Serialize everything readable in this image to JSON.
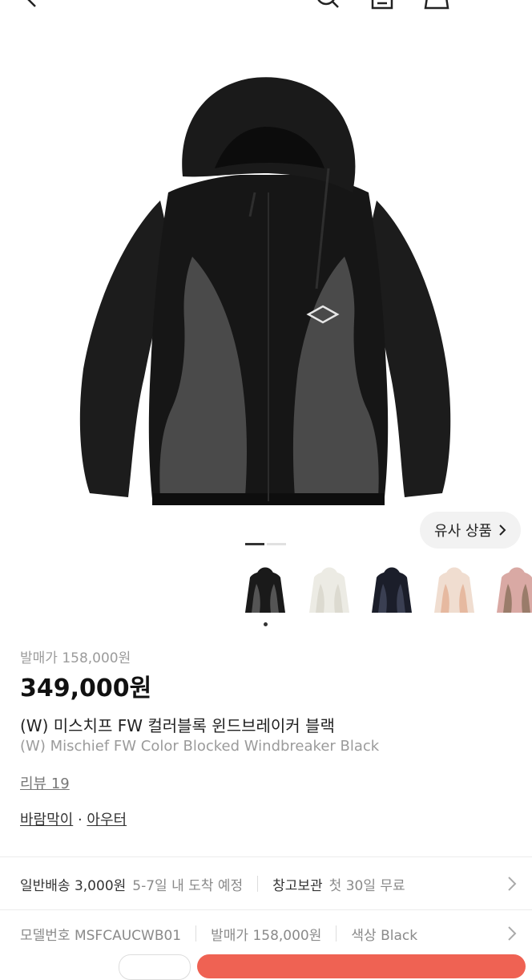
{
  "header": {
    "back_icon": "chevron-left-icon",
    "search_icon": "search-icon",
    "share_icon": "share-icon",
    "cart_icon": "shopping-bag-icon"
  },
  "gallery": {
    "similar_button_label": "유사 상품",
    "page_count": 2,
    "current_page": 1,
    "thumbnails": [
      {
        "color": "Black/Charcoal",
        "selected": true
      },
      {
        "color": "Ivory",
        "selected": false
      },
      {
        "color": "Navy",
        "selected": false
      },
      {
        "color": "Peach",
        "selected": false
      },
      {
        "color": "Pink/Brown",
        "selected": false
      }
    ]
  },
  "product": {
    "release_price_label": "발매가 158,000원",
    "price": "349,000원",
    "name_ko": "(W) 미스치프 FW 컬러블록 윈드브레이커 블랙",
    "name_en": "(W) Mischief FW Color Blocked Windbreaker Black",
    "reviews": "리뷰 19",
    "category_1": "바람막이",
    "category_sep": " · ",
    "category_2": "아우터"
  },
  "delivery": {
    "normal_label": "일반배송 3,000원",
    "normal_eta": "5-7일 내 도착 예정",
    "storage_label": "창고보관",
    "storage_note": "첫 30일 무료"
  },
  "specs": {
    "model_label": "모델번호 MSFCAUCWB01",
    "release_label": "발매가 158,000원",
    "color_label": "색상 Black"
  },
  "colors": {
    "accent": "#ef6253",
    "jacket_body": "#1a1a1a",
    "jacket_panel": "#4a4a4a"
  }
}
